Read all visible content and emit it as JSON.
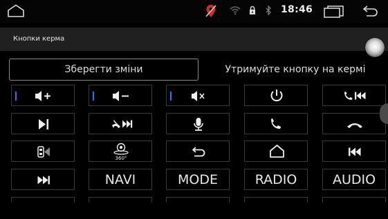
{
  "status_bar": {
    "time": "18:46",
    "icons": [
      "home-outline-icon",
      "no-gps-icon",
      "wifi-icon",
      "lock-icon",
      "bluetooth-icon",
      "recent-apps-icon",
      "back-icon"
    ]
  },
  "header": {
    "title": "Кнопки керма"
  },
  "actions": {
    "save_label": "Зберегти зміни",
    "hint": "Утримуйте кнопку на кермі"
  },
  "buttons": [
    {
      "id": "vol-up",
      "icon": "volume-up-icon",
      "label": "",
      "marked": true
    },
    {
      "id": "vol-down",
      "icon": "volume-down-icon",
      "label": "",
      "marked": true
    },
    {
      "id": "mute",
      "icon": "mute-icon",
      "label": "",
      "marked": true
    },
    {
      "id": "power",
      "icon": "power-icon",
      "label": "",
      "marked": false
    },
    {
      "id": "call-prev",
      "icon": "call-previous-icon",
      "label": "",
      "marked": false
    },
    {
      "id": "play-pause",
      "icon": "play-pause-icon",
      "label": "",
      "marked": false
    },
    {
      "id": "hangup-next",
      "icon": "hangup-next-icon",
      "label": "",
      "marked": false
    },
    {
      "id": "voice",
      "icon": "microphone-icon",
      "label": "",
      "marked": false
    },
    {
      "id": "call",
      "icon": "phone-icon",
      "label": "",
      "marked": false
    },
    {
      "id": "hangup",
      "icon": "hangup-icon",
      "label": "",
      "marked": false
    },
    {
      "id": "camera",
      "icon": "rear-camera-icon",
      "label": "",
      "marked": false
    },
    {
      "id": "cam360",
      "icon": "camera-360-icon",
      "label": "",
      "marked": false
    },
    {
      "id": "back",
      "icon": "back-arrow-icon",
      "label": "",
      "marked": false
    },
    {
      "id": "home",
      "icon": "home-icon",
      "label": "",
      "marked": false
    },
    {
      "id": "prev",
      "icon": "previous-track-icon",
      "label": "",
      "marked": false
    },
    {
      "id": "next",
      "icon": "next-track-icon",
      "label": "",
      "marked": false
    },
    {
      "id": "navi",
      "icon": "",
      "label": "NAVI",
      "marked": false
    },
    {
      "id": "mode",
      "icon": "",
      "label": "MODE",
      "marked": false
    },
    {
      "id": "radio",
      "icon": "",
      "label": "RADIO",
      "marked": false
    },
    {
      "id": "audio",
      "icon": "",
      "label": "AUDIO",
      "marked": false
    }
  ],
  "colors": {
    "accent_marker": "#1e7cff",
    "background": "#000000",
    "header_bg": "#202020",
    "border": "#3a3a3a"
  }
}
